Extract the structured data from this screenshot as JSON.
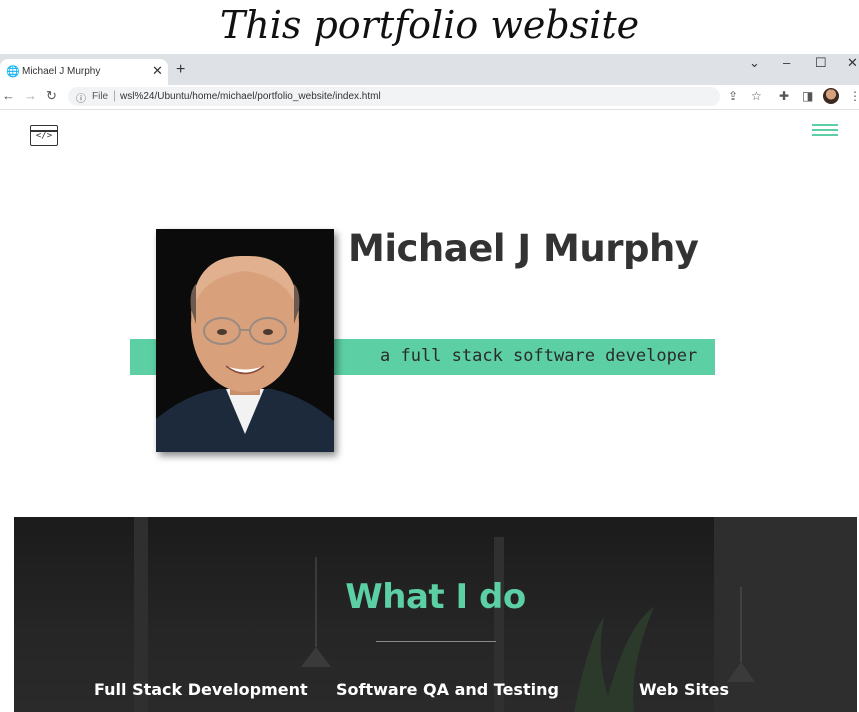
{
  "caption": "This portfolio website",
  "browser": {
    "tab_title": "Michael J Murphy",
    "tab_close": "✕",
    "new_tab": "+",
    "address_label": "File",
    "url": "wsl%24/Ubuntu/home/michael/portfolio_website/index.html",
    "window_controls": [
      "⌄",
      "–",
      "☐",
      "✕"
    ]
  },
  "page": {
    "logo_code": "</>",
    "name": "Michael J Murphy",
    "tagline": "a full stack software developer",
    "section_title": "What I do",
    "services": [
      "Full Stack Development",
      "Software QA and Testing",
      "Web Sites"
    ]
  },
  "colors": {
    "accent": "#5ccfa4",
    "dark_bg": "#222222",
    "text": "#333333"
  }
}
